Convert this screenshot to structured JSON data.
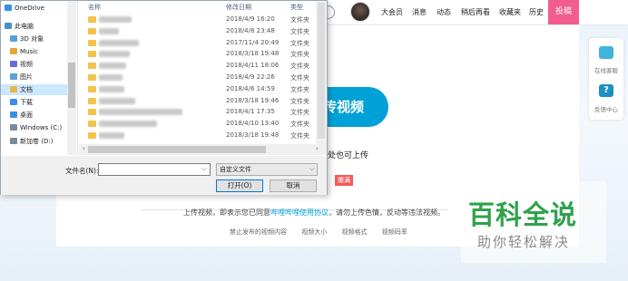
{
  "webpage": {
    "nav": [
      "大会员",
      "消息",
      "动态",
      "稍后再看",
      "收藏夹",
      "历史"
    ],
    "post_button": "投稿",
    "upload_button": "传视频",
    "drag_hint": "处也可上传",
    "badge": "爆满",
    "agreement_prefix": "上传视频，即表示您已同意",
    "agreement_link": "哔哩哔哩使用协议",
    "agreement_suffix": "，请勿上传色情，反动等违法视频。",
    "bottom_links": [
      "禁止发布的视频内容",
      "视频大小",
      "视频格式",
      "视频码率"
    ],
    "right_panel": {
      "service": "在线客服",
      "help": "反馈中心",
      "help_glyph": "?"
    }
  },
  "watermark": {
    "title": "百科全说",
    "subtitle": "助你轻松解决"
  },
  "dialog": {
    "columns": {
      "name": "名称",
      "modified": "修改日期",
      "type": "类型"
    },
    "tree": [
      {
        "label": "OneDrive",
        "color": "#3a8ee6"
      },
      {
        "label": "此电脑",
        "color": "#4a90c8"
      },
      {
        "label": "3D 对象",
        "color": "#5aa0d8"
      },
      {
        "label": "Music",
        "color": "#e8a23a"
      },
      {
        "label": "视频",
        "color": "#6b6bd6"
      },
      {
        "label": "图片",
        "color": "#5aa0d8"
      },
      {
        "label": "文档",
        "color": "#e6b84a"
      },
      {
        "label": "下载",
        "color": "#3a8ee6"
      },
      {
        "label": "桌面",
        "color": "#3a8ee6"
      },
      {
        "label": "Windows (C:)",
        "color": "#7a8a9a"
      },
      {
        "label": "新加卷 (D:)",
        "color": "#7a8a9a"
      }
    ],
    "files": [
      {
        "date": "2018/4/9 16:20",
        "type": "文件夹"
      },
      {
        "date": "2018/4/8 23:48",
        "type": "文件夹"
      },
      {
        "date": "2017/11/4 20:49",
        "type": "文件夹"
      },
      {
        "date": "2018/3/18 19:48",
        "type": "文件夹"
      },
      {
        "date": "2018/4/11 18:06",
        "type": "文件夹"
      },
      {
        "date": "2018/4/9 22:26",
        "type": "文件夹"
      },
      {
        "date": "2018/4/6 14:59",
        "type": "文件夹"
      },
      {
        "date": "2018/3/18 19:46",
        "type": "文件夹"
      },
      {
        "date": "2018/4/1 17:35",
        "type": "文件夹"
      },
      {
        "date": "2018/4/10 13:40",
        "type": "文件夹"
      },
      {
        "date": "2018/3/18 19:48",
        "type": "文件夹"
      }
    ],
    "filename_label": "文件名(N):",
    "filename_value": "",
    "filetype_value": "自定义文件",
    "open_button": "打开(O)",
    "cancel_button": "取消",
    "dropdown_glyph": "⌵",
    "scroll_left_glyph": "‹",
    "scroll_right_glyph": "›"
  }
}
